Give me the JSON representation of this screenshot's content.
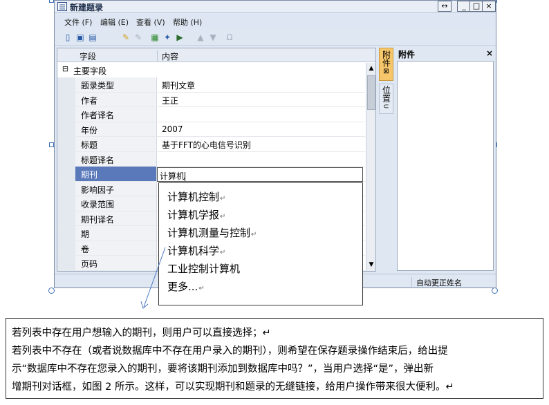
{
  "window": {
    "title": "新建题录",
    "controls": {
      "move": "↔",
      "minimize": "_",
      "maximize": "□",
      "close": "×"
    }
  },
  "menu": {
    "items": [
      "文件 (F)",
      "编辑 (E)",
      "查看 (V)",
      "帮助 (H)"
    ]
  },
  "toolbar": {
    "icons": [
      "new-icon",
      "save-icon",
      "save-copy-icon",
      "clear-icon",
      "disabled-clear-icon",
      "grid-icon",
      "pin-icon",
      "export-icon",
      "up-icon",
      "down-icon",
      "omega-icon"
    ]
  },
  "grid": {
    "columns": {
      "field": "字段",
      "content": "内容"
    },
    "group": {
      "toggle": "⊟",
      "label": "主要字段"
    },
    "rows": [
      {
        "field": "题录类型",
        "value": "期刊文章"
      },
      {
        "field": "作者",
        "value": "王正"
      },
      {
        "field": "作者译名",
        "value": ""
      },
      {
        "field": "年份",
        "value": "2007"
      },
      {
        "field": "标题",
        "value": "基于FFT的心电信号识别"
      },
      {
        "field": "标题译名",
        "value": ""
      },
      {
        "field": "期刊",
        "value": ""
      },
      {
        "field": "影响因子",
        "value": ""
      },
      {
        "field": "收录范围",
        "value": ""
      },
      {
        "field": "期刊译名",
        "value": ""
      },
      {
        "field": "期",
        "value": ""
      },
      {
        "field": "卷",
        "value": ""
      },
      {
        "field": "页码",
        "value": ""
      }
    ],
    "input_value": "计算机"
  },
  "side_tabs": {
    "attachment": "附件",
    "location": "位置"
  },
  "attachment_panel": {
    "title": "附件",
    "close": "×"
  },
  "statusbar": {
    "text": "自动更正姓名"
  },
  "dropdown": {
    "options": [
      "计算机控制",
      "计算机学报",
      "计算机测量与控制",
      "计算机科学",
      "工业控制计算机",
      "更多..."
    ],
    "pilcrow": "↵"
  },
  "annotation": {
    "lines": [
      "若列表中存在用户想输入的期刊，则用户可以直接选择；↵",
      "若列表中不存在（或者说数据库中不存在用户录入的期刊），则希望在保存题录操作结束后，给出提",
      "示“数据库中不存在您录入的期刊，要将该期刊添加到数据库中吗？”，当用户选择“是”，弹出新",
      "增期刊对话框，如图 2 所示。这样，可以实现期刊和题录的无缝链接，给用户操作带来很大便利。↵"
    ]
  },
  "colors": {
    "selected_row": "#5979bb",
    "attachment_tab": "#f7c66b",
    "window_bg": "#dfe7f3"
  }
}
